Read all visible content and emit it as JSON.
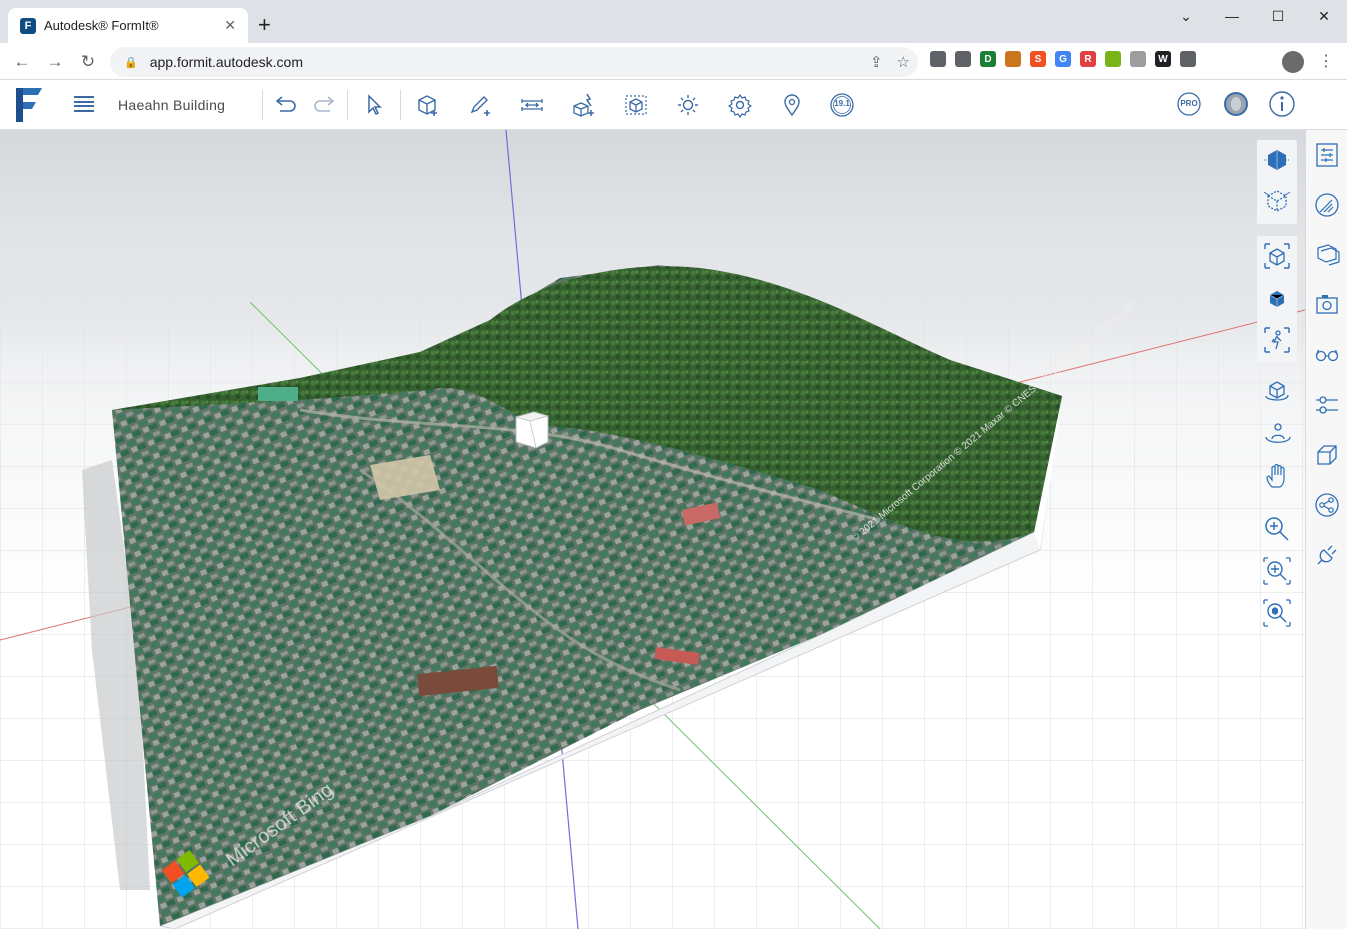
{
  "browser": {
    "tab_title": "Autodesk® FormIt®",
    "favicon_letter": "F",
    "url": "app.formit.autodesk.com",
    "window_controls": [
      "minimize-icon",
      "maximize-icon",
      "close-icon"
    ],
    "extensions": [
      {
        "name": "camera-icon",
        "color": "#5f6368"
      },
      {
        "name": "extension-icon-1",
        "color": "#5f6368"
      },
      {
        "name": "extension-icon-d",
        "color": "#1a7f37",
        "letter": "D"
      },
      {
        "name": "extension-icon-2",
        "color": "#c9761e"
      },
      {
        "name": "extension-icon-s",
        "color": "#f25022",
        "letter": "S"
      },
      {
        "name": "translate-icon",
        "color": "#4285f4",
        "letter": "G"
      },
      {
        "name": "extension-icon-r",
        "color": "#e04040",
        "letter": "R"
      },
      {
        "name": "extension-icon-3",
        "color": "#7ab317"
      },
      {
        "name": "extension-icon-4",
        "color": "#9e9e9e"
      },
      {
        "name": "extension-icon-w",
        "color": "#202124",
        "letter": "W"
      },
      {
        "name": "puzzle-icon",
        "color": "#5f6368"
      }
    ]
  },
  "app": {
    "project_name": "Haeahn Building",
    "accent": "#3b6ba5",
    "version_badge": "19.1",
    "pro_badge": "PRO",
    "toolbar": [
      "undo-icon",
      "redo-icon",
      "select-icon",
      "cube-add-icon",
      "sketch-pencil-icon",
      "measure-icon",
      "shape-tools-icon",
      "group-icon",
      "sun-icon",
      "settings-icon",
      "location-pin-icon"
    ]
  },
  "viewport": {
    "map_attribution": "© 2021 Microsoft Corporation © 2021 Maxar © CNES (2021) Distribution Airbus DS",
    "bing_logo_text": "Microsoft Bing",
    "view_tools_top": [
      "3d-view-icon",
      "section-box-icon"
    ],
    "view_tools_mid": [
      "perspective-view-icon",
      "solid-view-icon",
      "walk-icon"
    ],
    "view_tools_nav": [
      "orbit-icon",
      "look-around-icon",
      "pan-icon",
      "zoom-icon",
      "zoom-extents-icon",
      "zoom-selected-icon"
    ]
  },
  "right_panel": [
    "properties-icon",
    "materials-icon",
    "layers-icon",
    "scenes-icon",
    "visual-styles-icon",
    "levels-icon",
    "groups-icon",
    "plugins-icon",
    "connections-icon"
  ]
}
